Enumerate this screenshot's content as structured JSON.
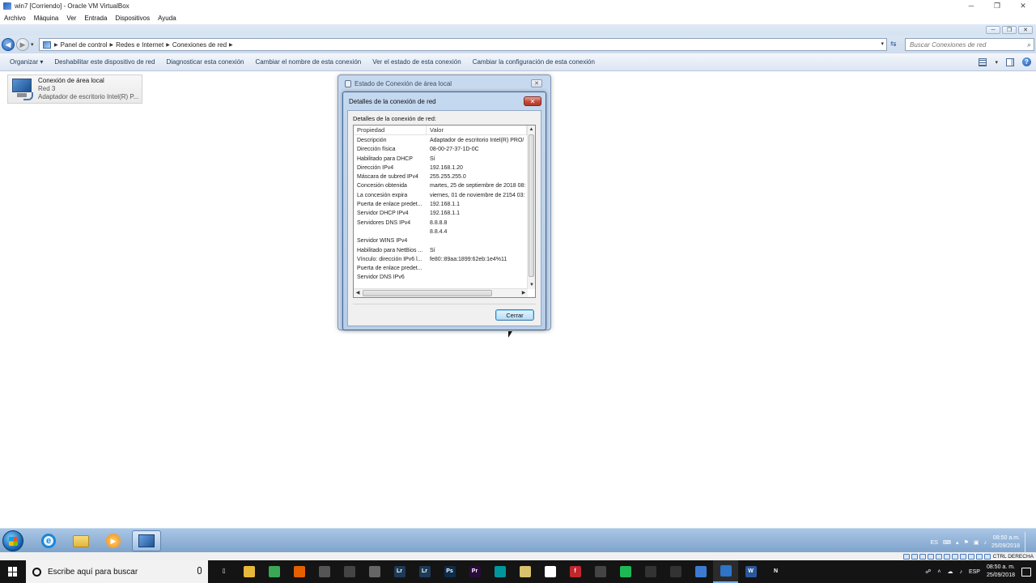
{
  "host_window": {
    "title": "win7 [Corriendo] - Oracle VM VirtualBox",
    "menu": [
      "Archivo",
      "Máquina",
      "Ver",
      "Entrada",
      "Dispositivos",
      "Ayuda"
    ]
  },
  "explorer": {
    "breadcrumb": [
      "Panel de control",
      "Redes e Internet",
      "Conexiones de red"
    ],
    "search_placeholder": "Buscar Conexiones de red",
    "commands": [
      "Organizar",
      "Deshabilitar este dispositivo de red",
      "Diagnosticar esta conexión",
      "Cambiar el nombre de esta conexión",
      "Ver el estado de esta conexión",
      "Cambiar la configuración de esta conexión"
    ],
    "connection": {
      "name": "Conexión de área local",
      "network": "Red 3",
      "adapter": "Adaptador de escritorio Intel(R) P..."
    }
  },
  "status_dialog": {
    "title": "Estado de Conexión de área local"
  },
  "details_dialog": {
    "title": "Detalles de la conexión de red",
    "label": "Detalles de la conexión de red:",
    "columns": [
      "Propiedad",
      "Valor"
    ],
    "rows": [
      [
        "Descripción",
        "Adaptador de escritorio Intel(R) PRO/"
      ],
      [
        "Dirección física",
        "08-00-27-37-1D-0C"
      ],
      [
        "Habilitado para DHCP",
        "Sí"
      ],
      [
        "Dirección IPv4",
        "192.168.1.20"
      ],
      [
        "Máscara de subred IPv4",
        "255.255.255.0"
      ],
      [
        "Concesión obtenida",
        "martes, 25 de septiembre de 2018 08:"
      ],
      [
        "La concesión expira",
        "viernes, 01 de noviembre de 2154 03:"
      ],
      [
        "Puerta de enlace predet...",
        "192.168.1.1"
      ],
      [
        "Servidor DHCP IPv4",
        "192.168.1.1"
      ],
      [
        "Servidores DNS IPv4",
        "8.8.8.8"
      ],
      [
        "",
        "8.8.4.4"
      ],
      [
        "Servidor WINS IPv4",
        ""
      ],
      [
        "Habilitado para NetBios ...",
        "Sí"
      ],
      [
        "Vínculo: dirección IPv6 l...",
        "fe80::89aa:1899:62eb:1e4%11"
      ],
      [
        "Puerta de enlace predet...",
        ""
      ],
      [
        "Servidor DNS IPv6",
        ""
      ]
    ],
    "close_label": "Cerrar"
  },
  "guest_taskbar": {
    "apps": [
      "internet-explorer",
      "windows-explorer",
      "media-player",
      "network-connections"
    ],
    "lang": "ES",
    "time": "08:50 a.m.",
    "date": "25/09/2018"
  },
  "vbox_status": {
    "host_key": "CTRL DERECHA"
  },
  "host_taskbar": {
    "search_placeholder": "Escribe aquí para buscar",
    "lang": "ESP",
    "time": "08:50 a. m.",
    "date": "25/09/2018",
    "apps": [
      {
        "name": "task-view",
        "color": "#141414",
        "glyph": "▯"
      },
      {
        "name": "file-explorer",
        "color": "#e8b83a",
        "glyph": ""
      },
      {
        "name": "chrome",
        "color": "#3aa757",
        "glyph": ""
      },
      {
        "name": "firefox",
        "color": "#e66000",
        "glyph": ""
      },
      {
        "name": "store",
        "color": "#555555",
        "glyph": ""
      },
      {
        "name": "calculator",
        "color": "#444444",
        "glyph": ""
      },
      {
        "name": "camera",
        "color": "#666666",
        "glyph": ""
      },
      {
        "name": "lightroom-classic",
        "color": "#1d3a57",
        "glyph": "Lr"
      },
      {
        "name": "lightroom",
        "color": "#1d3a57",
        "glyph": "Lr"
      },
      {
        "name": "photoshop",
        "color": "#0b2d4d",
        "glyph": "Ps"
      },
      {
        "name": "premiere",
        "color": "#2a0b3d",
        "glyph": "Pr"
      },
      {
        "name": "arduino",
        "color": "#00979c",
        "glyph": ""
      },
      {
        "name": "notes",
        "color": "#d9c26b",
        "glyph": ""
      },
      {
        "name": "itunes",
        "color": "#ffffff",
        "glyph": ""
      },
      {
        "name": "flash",
        "color": "#c1272d",
        "glyph": "f"
      },
      {
        "name": "phone",
        "color": "#444444",
        "glyph": ""
      },
      {
        "name": "spotify",
        "color": "#1db954",
        "glyph": ""
      },
      {
        "name": "photos",
        "color": "#333333",
        "glyph": ""
      },
      {
        "name": "speedometer",
        "color": "#333333",
        "glyph": ""
      },
      {
        "name": "globe",
        "color": "#3d7bd1",
        "glyph": ""
      },
      {
        "name": "virtualbox",
        "color": "#2e74c9",
        "glyph": ""
      },
      {
        "name": "word",
        "color": "#2b579a",
        "glyph": "W"
      },
      {
        "name": "netflix",
        "color": "#141414",
        "glyph": "N"
      },
      {
        "name": "settings",
        "color": "#141414",
        "glyph": ""
      },
      {
        "name": "system-monitor",
        "color": "#141414",
        "glyph": ""
      }
    ]
  }
}
